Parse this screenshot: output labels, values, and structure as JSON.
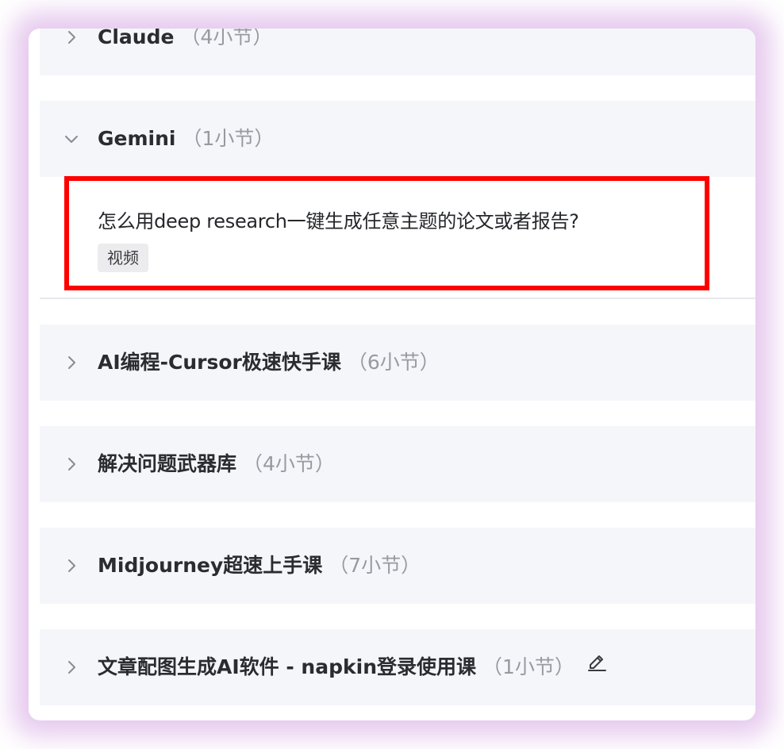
{
  "sections": [
    {
      "title": "Claude",
      "count": "（4小节）",
      "expanded": false,
      "icon": "chevron-right-icon"
    },
    {
      "title": "Gemini",
      "count": "（1小节）",
      "expanded": true,
      "icon": "chevron-down-icon"
    },
    {
      "title": "AI编程-Cursor极速快手课",
      "count": "（6小节）",
      "expanded": false,
      "icon": "chevron-right-icon"
    },
    {
      "title": "解决问题武器库",
      "count": "（4小节）",
      "expanded": false,
      "icon": "chevron-right-icon"
    },
    {
      "title": "Midjourney超速上手课",
      "count": "（7小节）",
      "expanded": false,
      "icon": "chevron-right-icon"
    },
    {
      "title": "文章配图生成AI软件 - napkin登录使用课",
      "count": "（1小节）",
      "expanded": false,
      "icon": "chevron-right-icon",
      "extra_icon": "edit-icon"
    }
  ],
  "lesson": {
    "title": "怎么用deep research一键生成任意主题的论文或者报告?",
    "tag": "视频",
    "highlight_color": "#ff0000"
  },
  "colors": {
    "section_bg": "#f5f6fa",
    "title_text": "#2b2c30",
    "count_text": "#999aa0",
    "glow": "#e6c9ee"
  }
}
